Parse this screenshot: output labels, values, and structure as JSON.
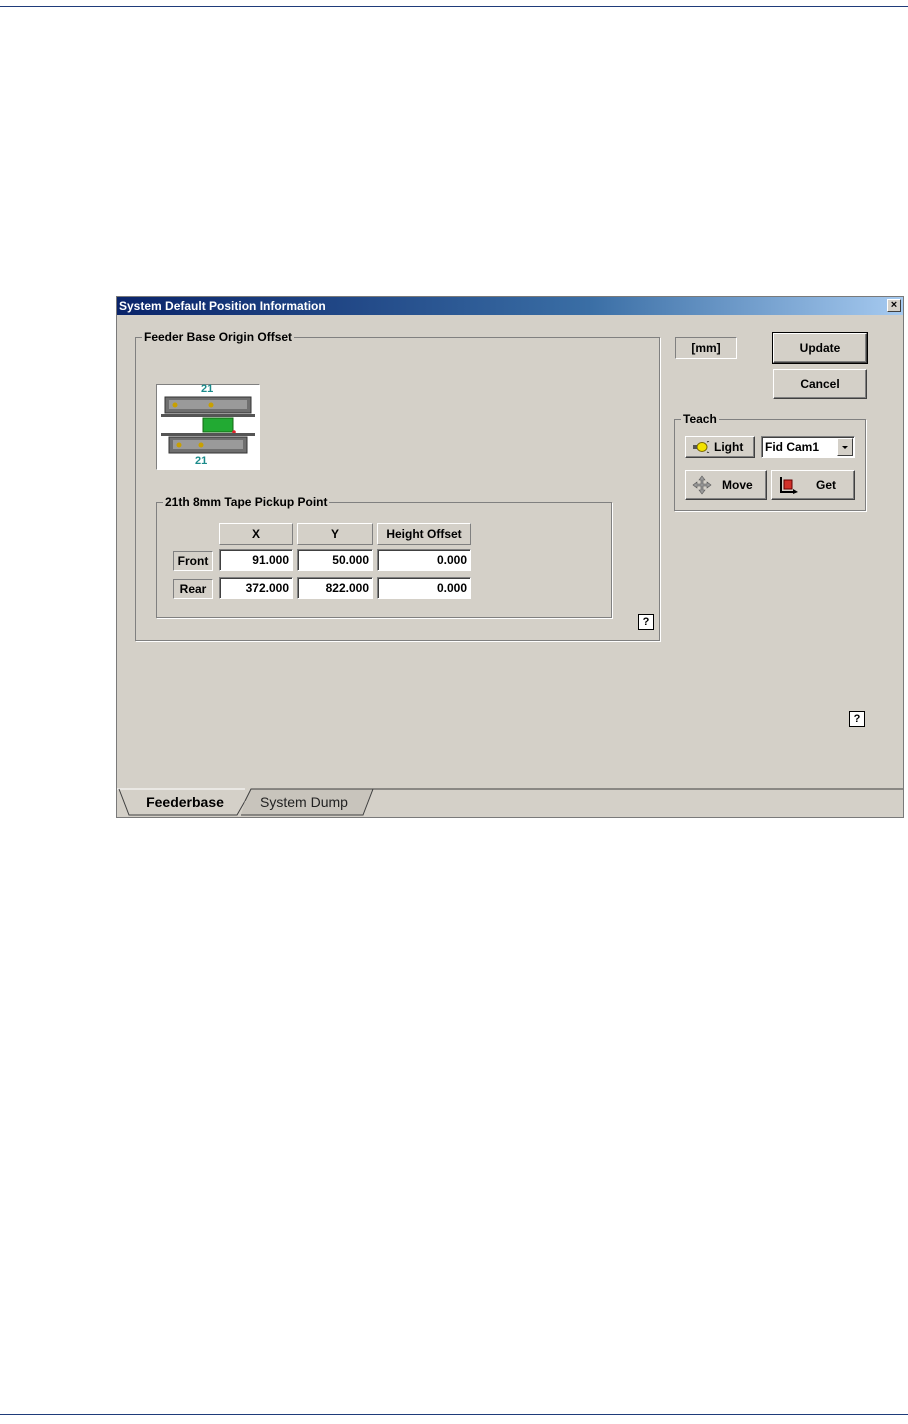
{
  "dialog": {
    "title": "System Default Position Information",
    "close_glyph": "×"
  },
  "feeder_group": {
    "title": "Feeder Base Origin Offset",
    "diagram": {
      "top_label": "21",
      "bottom_label": "21"
    }
  },
  "pickup_group": {
    "title": "21th 8mm Tape Pickup Point",
    "columns": [
      "X",
      "Y",
      "Height Offset"
    ],
    "rows": [
      {
        "label": "Front",
        "values": [
          "91.000",
          "50.000",
          "0.000"
        ]
      },
      {
        "label": "Rear",
        "values": [
          "372.000",
          "822.000",
          "0.000"
        ]
      }
    ]
  },
  "unit_label": "[mm]",
  "buttons": {
    "update": "Update",
    "cancel": "Cancel"
  },
  "teach": {
    "title": "Teach",
    "light_label": "Light",
    "camera_select": "Fid Cam1",
    "move_label": "Move",
    "get_label": "Get"
  },
  "help_glyph": "?",
  "tabs": [
    {
      "label": "Feederbase",
      "active": true
    },
    {
      "label": "System Dump",
      "active": false
    }
  ],
  "colors": {
    "titlebar_start": "#0a246a",
    "dialog_bg": "#d4d0c8",
    "rule_line": "#1f3b7a"
  }
}
